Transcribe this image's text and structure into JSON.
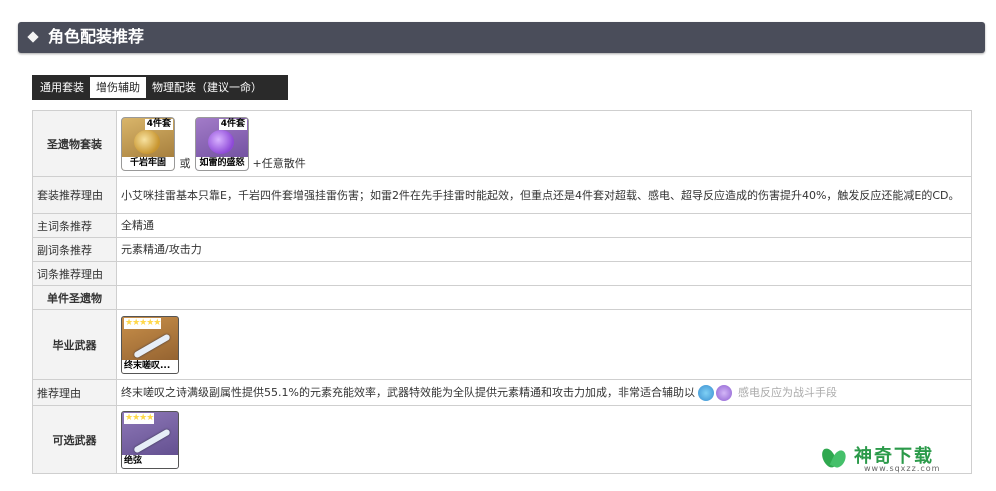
{
  "header": {
    "title": "角色配装推荐"
  },
  "tabs": [
    {
      "label": "通用套装",
      "active": false
    },
    {
      "label": "增伤辅助",
      "active": true
    },
    {
      "label": "物理配装（建议一命）",
      "active": false
    }
  ],
  "rows": {
    "artifact_set": {
      "label": "圣遗物套装",
      "items": [
        {
          "tag": "4件套",
          "name": "千岩牢固",
          "icon": "geo-flower-icon"
        },
        {
          "tag": "4件套",
          "name": "如雷的盛怒",
          "icon": "electro-flower-icon"
        }
      ],
      "or_text": "或",
      "any_text": "+任意散件"
    },
    "set_reason": {
      "label": "套装推荐理由",
      "text": "小艾咪挂雷基本只靠E，千岩四件套增强挂雷伤害；如雷2件在先手挂雷时能起效，但重点还是4件套对超载、感电、超导反应造成的伤害提升40%，触发反应还能减E的CD。"
    },
    "main_stat": {
      "label": "主词条推荐",
      "text": "全精通"
    },
    "sub_stat": {
      "label": "副词条推荐",
      "text": "元素精通/攻击力"
    },
    "stat_reason": {
      "label": "词条推荐理由",
      "text": ""
    },
    "single_artifact": {
      "label": "单件圣遗物",
      "text": ""
    },
    "best_weapon": {
      "label": "毕业武器",
      "weapon": {
        "stars": "★★★★★",
        "name": "终末嗟叹...",
        "icon": "bow-icon"
      }
    },
    "weapon_reason": {
      "label": "推荐理由",
      "text": "终末嗟叹之诗满级副属性提供55.1%的元素充能效率，武器特效能为全队提供元素精通和攻击力加成，非常适合辅助以",
      "faded_text": "感电反应为战斗手段"
    },
    "alt_weapon": {
      "label": "可选武器",
      "weapon": {
        "stars": "★★★★",
        "name": "绝弦",
        "icon": "bow-icon"
      }
    }
  },
  "watermark": {
    "brand": "神奇下载",
    "url": "www.sqxzz.com"
  }
}
